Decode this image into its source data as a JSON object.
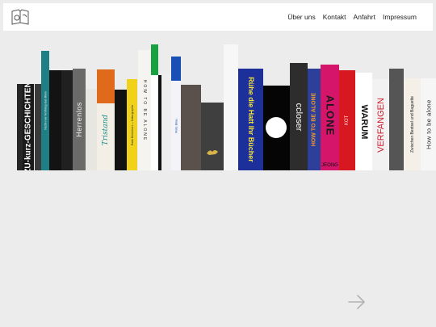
{
  "nav": {
    "items": [
      "Über uns",
      "Kontakt",
      "Anfahrt",
      "Impressum"
    ]
  },
  "books": {
    "b1": "ZU-kurz-GESCHICHTEN",
    "b3": "Nicht-nur-Nothing-but-Rien",
    "b6": "Herrenlos",
    "b7": "Tristand",
    "b9": "Rudo Berkelson — Naturgraphie",
    "b10": "HOW TO BE ALONE",
    "b11": "Zwischen Bestsel und Baguette",
    "b14": "Rote Blau",
    "b18": "Rühe die Hatt Ihr Bücher",
    "b19": "Tanzerlebte die Ruhe",
    "b21": "ccloser",
    "b22": "HOW TO BE ALONE",
    "b23": "ALONE",
    "b23sub": "JEONG",
    "b24": "KOT",
    "b25": "WARUM",
    "b26": "VERFANGEN",
    "b28": "Zwischen Bestsel und Baguette",
    "b29": "How to be alone"
  },
  "colors": {
    "background": "#ececec",
    "header": "#ffffff",
    "nav_text": "#222222",
    "arrow": "#b3b3b3"
  },
  "icons": {
    "logo": "book-logo-icon",
    "next": "arrow-right-icon"
  }
}
